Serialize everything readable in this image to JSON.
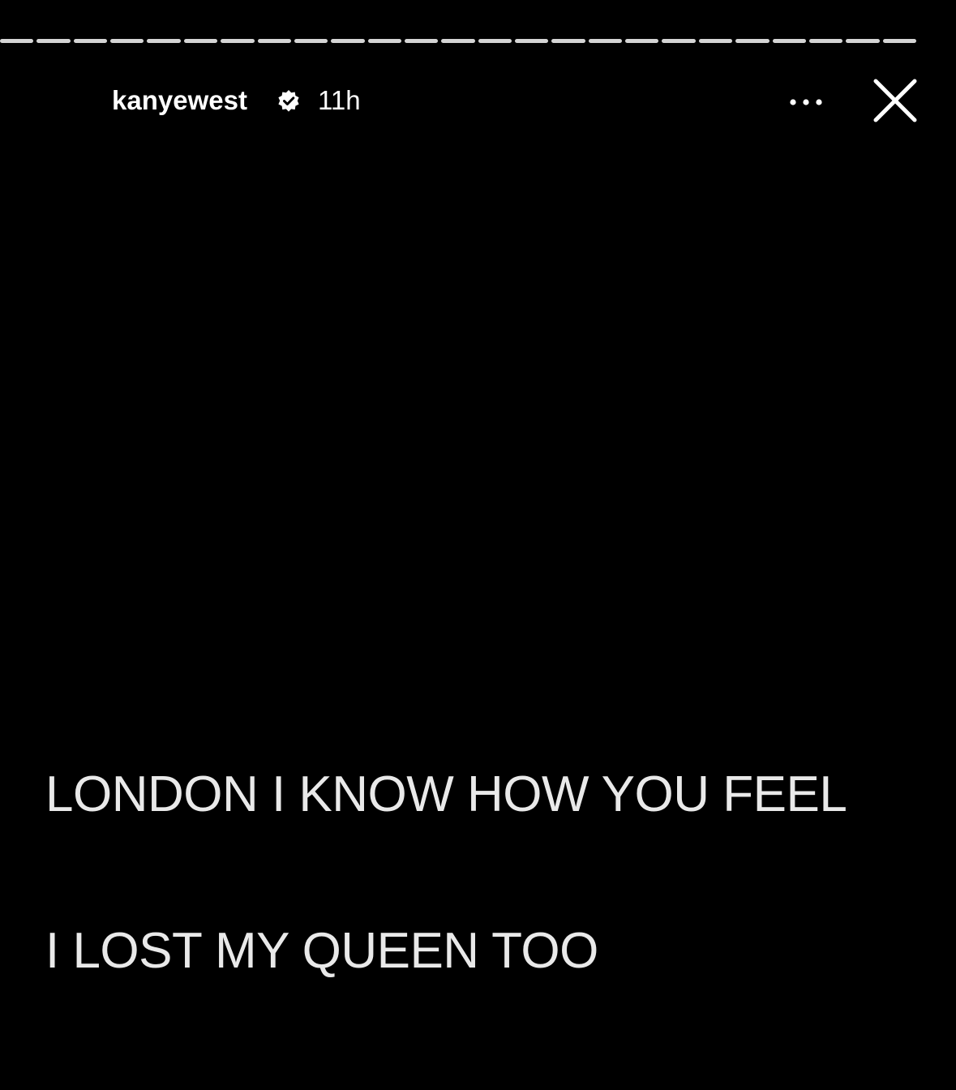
{
  "progress": {
    "segments": 25,
    "accent": "#d4d4d4"
  },
  "header": {
    "username": "kanyewest",
    "verified_icon": "verified-badge-icon",
    "time": "11h",
    "more_icon": "more-dots-icon",
    "close_icon": "close-icon"
  },
  "story": {
    "lines": [
      "LONDON I KNOW HOW YOU FEEL",
      "I LOST MY QUEEN TOO"
    ]
  },
  "colors": {
    "background": "#000000",
    "text": "#ffffff"
  }
}
